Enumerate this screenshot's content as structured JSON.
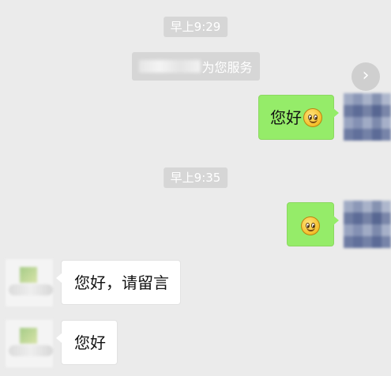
{
  "timestamps": [
    "早上9:29",
    "早上9:35"
  ],
  "system_notice": {
    "text": "为您服务"
  },
  "forward_button": {
    "icon": "chevron-right-icon",
    "glyph": "›"
  },
  "messages": [
    {
      "sender": "me",
      "text": "您好",
      "emoji": "smiley-emoji-icon"
    },
    {
      "sender": "me",
      "text": "",
      "emoji": "smiley-emoji-icon"
    },
    {
      "sender": "them",
      "text": "您好，请留言"
    },
    {
      "sender": "them",
      "text": "您好"
    }
  ],
  "colors": {
    "background": "#ebebeb",
    "outgoing_bubble": "#95ec69",
    "incoming_bubble": "#ffffff",
    "timestamp_pill": "#d6d6d6"
  }
}
